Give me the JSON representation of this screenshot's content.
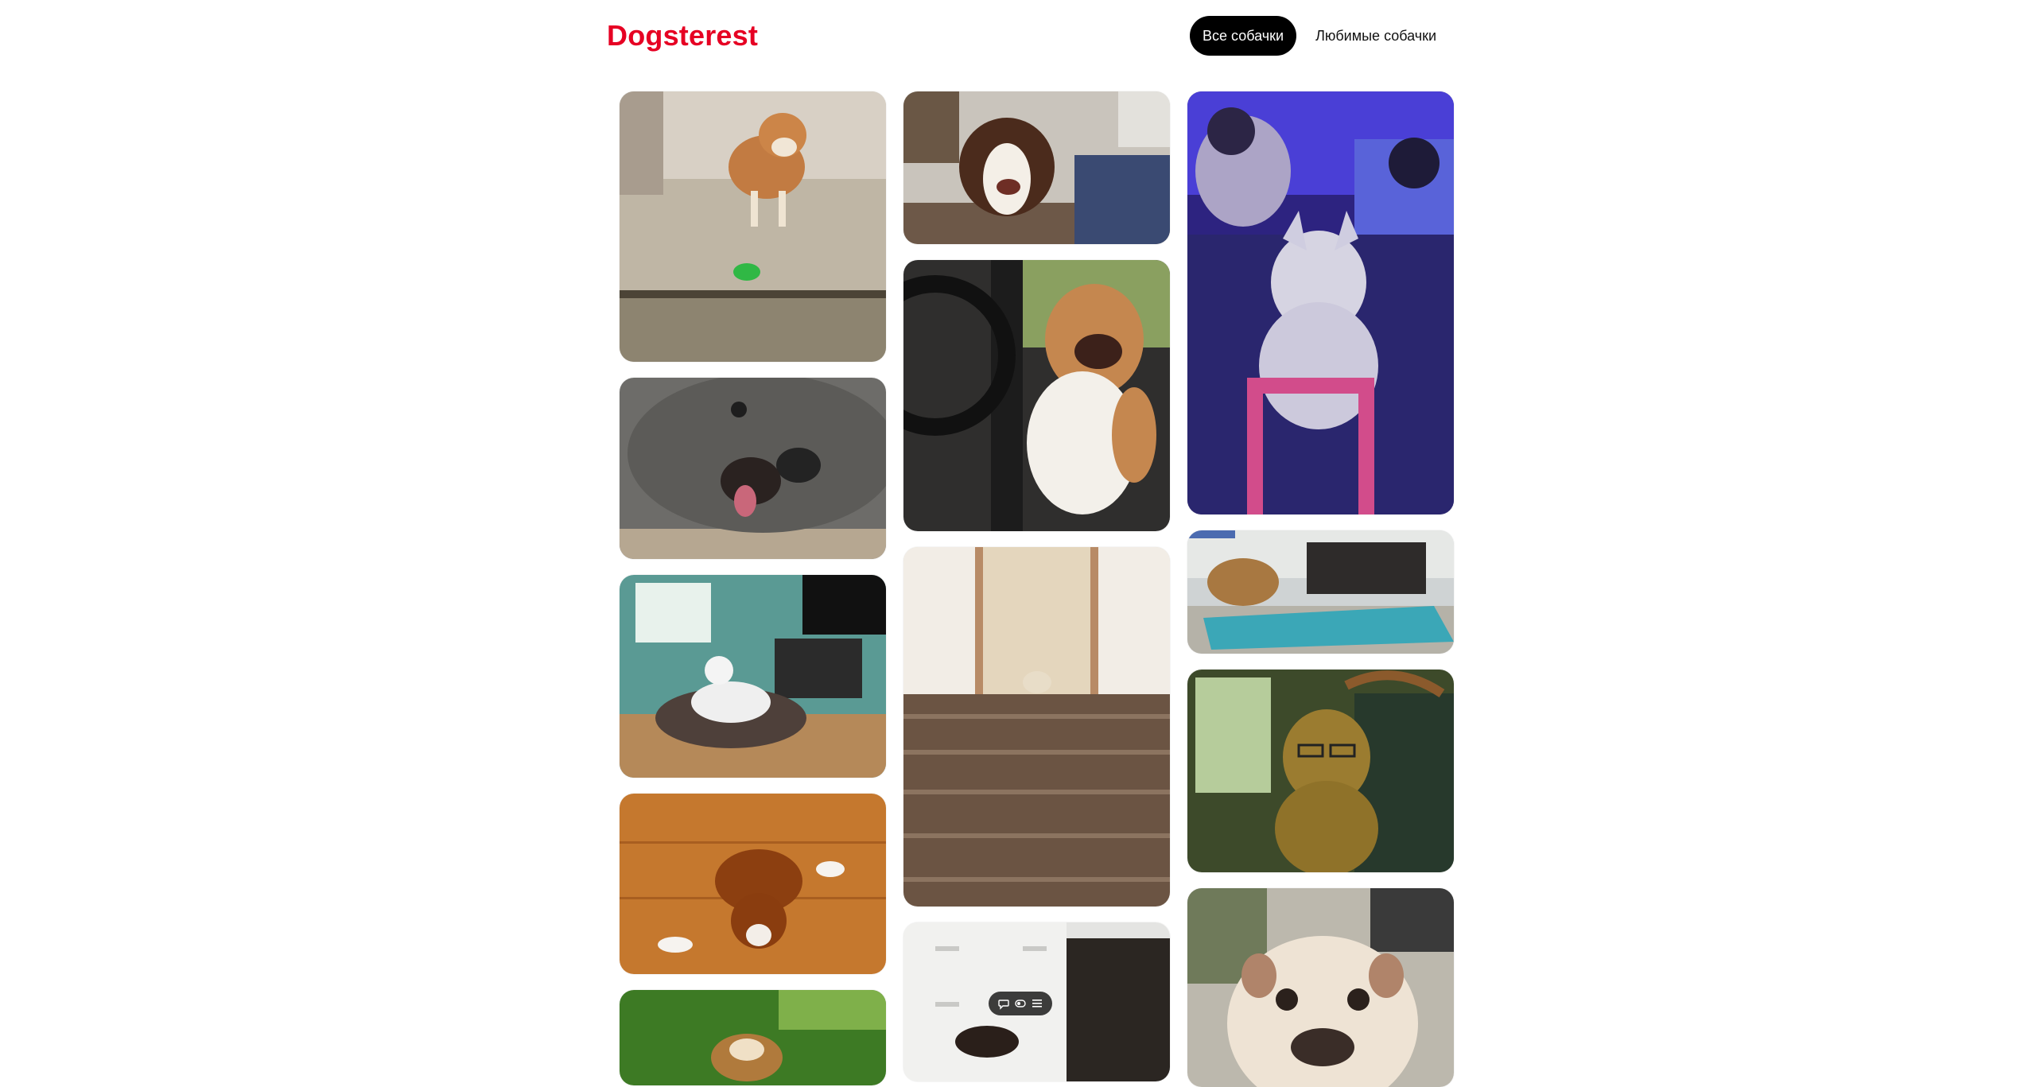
{
  "app": {
    "logo_text": "Dogsterest"
  },
  "nav": {
    "all_dogs_label": "Все собачки",
    "favorite_dogs_label": "Любимые собачки",
    "active_tab": "all"
  },
  "colors": {
    "brand": "#e60023",
    "active_tab_bg": "#000000",
    "page_bg": "#ffffff"
  },
  "feed": {
    "columns": 3,
    "images": [
      {
        "name": "dog-photo-shiba-with-frog-toy"
      },
      {
        "name": "dog-photo-grey-dog-lying"
      },
      {
        "name": "dog-photo-white-dog-on-bed"
      },
      {
        "name": "dog-photo-puppy-on-floor"
      },
      {
        "name": "dog-photo-bulldog-puppy-on-grass"
      },
      {
        "name": "dog-photo-spaniel-on-couch"
      },
      {
        "name": "dog-photo-poodle-in-car"
      },
      {
        "name": "dog-photo-dog-on-stairs"
      },
      {
        "name": "dog-photo-dog-by-drawers"
      },
      {
        "name": "dog-photo-husky-with-gamers"
      },
      {
        "name": "dog-photo-dog-on-yoga-mat"
      },
      {
        "name": "dog-photo-poodle-with-glasses"
      },
      {
        "name": "dog-photo-bulldog-closeup"
      }
    ]
  },
  "floating_toolbar": {
    "icons": [
      "chat-icon",
      "toggle-icon",
      "list-icon"
    ]
  }
}
